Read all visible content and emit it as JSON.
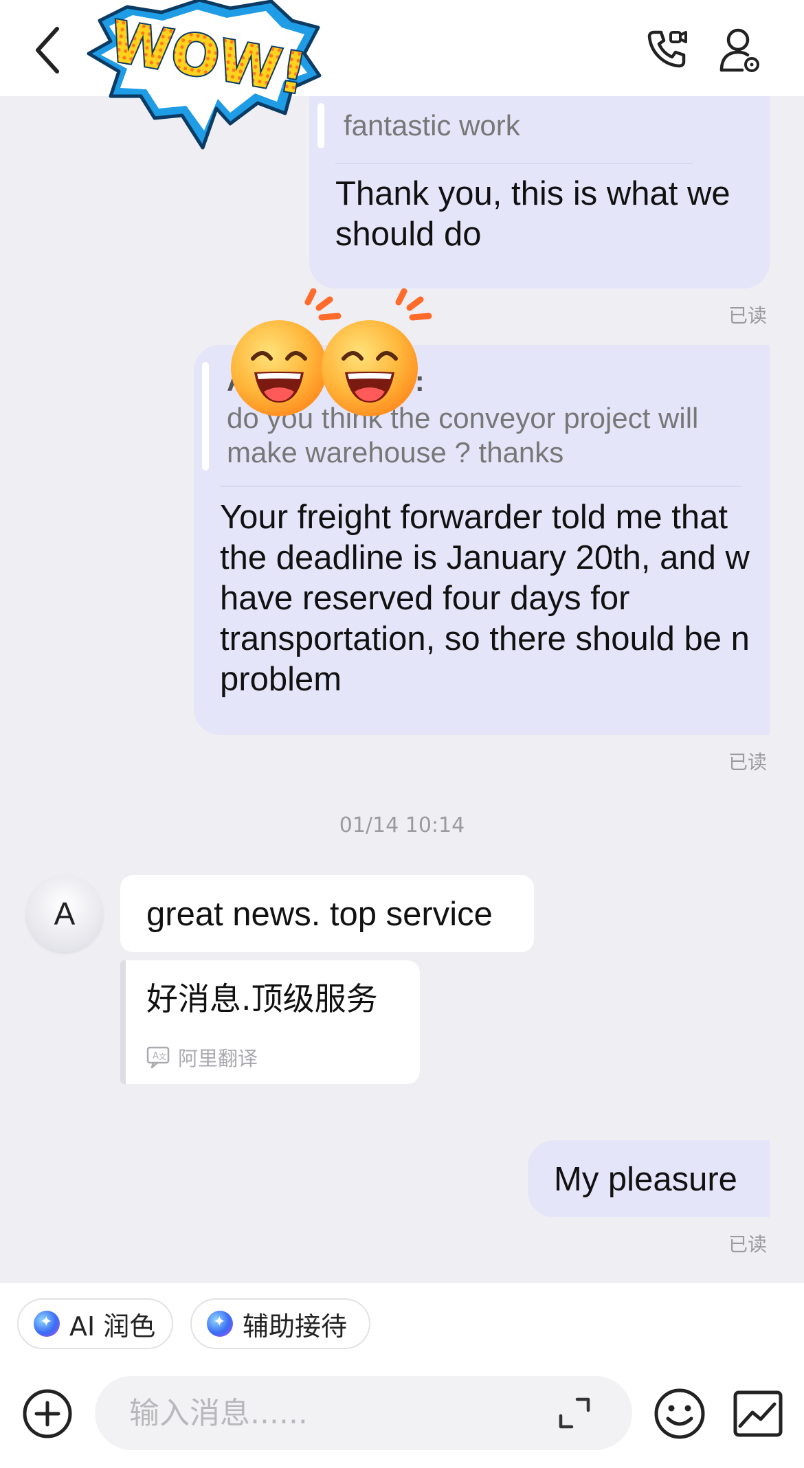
{
  "header": {
    "back_icon": "chevron-left-icon",
    "call_icon": "phone-video-icon",
    "profile_icon": "user-settings-icon",
    "sticker_text": "WOW!"
  },
  "messages": {
    "m1": {
      "quote": "fantastic work",
      "text_line1": "Thank you, this is what we",
      "text_line2": "should do",
      "read": "已读"
    },
    "m2": {
      "quote_author_visible": "A",
      "quote_author_tail": "s:",
      "quote_line1": "do you think the conveyor project will",
      "quote_line2": "make warehouse ? thanks",
      "text_line1": "Your freight forwarder told me that",
      "text_line2": "the deadline is January 20th, and w",
      "text_line3": "have reserved four days for",
      "text_line4": "transportation, so there should be n",
      "text_line5": "problem",
      "read": "已读"
    },
    "timestamp": "01/14 10:14",
    "m3": {
      "avatar_letter": "A",
      "text": "great news. top service",
      "translation": "好消息.顶级服务",
      "translation_source": "阿里翻译"
    },
    "m4": {
      "text": "My pleasure",
      "read": "已读"
    }
  },
  "toolbar": {
    "ai_polish_label": "AI 润色",
    "assist_label": "辅助接待"
  },
  "composer": {
    "placeholder": "输入消息......",
    "add_icon": "plus-circle-icon",
    "expand_icon": "expand-icon",
    "emoji_icon": "smile-icon",
    "image_icon": "image-icon"
  },
  "colors": {
    "outgoing_bubble": "#e5e5fa",
    "incoming_bubble": "#ffffff",
    "background": "#eeeef3"
  }
}
